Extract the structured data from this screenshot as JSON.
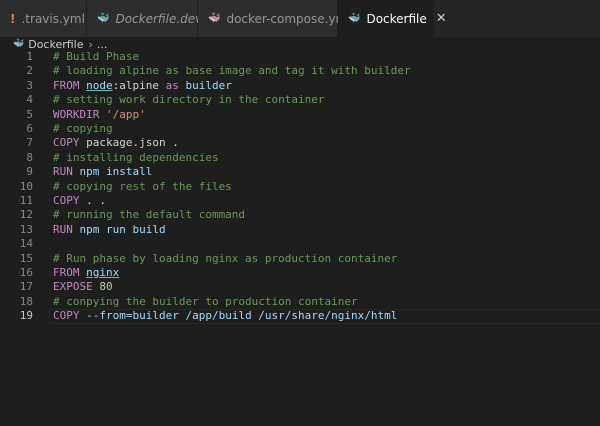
{
  "tabs": [
    {
      "label": ".travis.yml",
      "icon": "exclamation-icon",
      "icon_glyph": "!",
      "icon_color": "#e37933",
      "italic": false
    },
    {
      "label": "Dockerfile.dev",
      "icon": "docker-whale-icon",
      "icon_glyph": "🐳",
      "icon_color": "#519aba",
      "italic": true
    },
    {
      "label": "docker-compose.yml",
      "icon": "docker-compose-icon",
      "icon_glyph": "🐳",
      "icon_color": "#e44b7b",
      "italic": false
    },
    {
      "label": "Dockerfile",
      "icon": "docker-whale-icon",
      "icon_glyph": "🐳",
      "icon_color": "#519aba",
      "italic": false,
      "active": true,
      "close_glyph": "✕"
    }
  ],
  "breadcrumb": {
    "file": "Dockerfile",
    "sep": "›",
    "more": "..."
  },
  "editor": {
    "current_line": 19,
    "lines": [
      {
        "n": "1",
        "tokens": [
          {
            "t": "# Build Phase",
            "c": "cmt"
          }
        ]
      },
      {
        "n": "2",
        "tokens": [
          {
            "t": "# loading alpine as base image and tag it with builder",
            "c": "cmt"
          }
        ]
      },
      {
        "n": "3",
        "tokens": [
          {
            "t": "FROM",
            "c": "kw"
          },
          {
            "t": " "
          },
          {
            "t": "node",
            "c": "arg ul"
          },
          {
            "t": ":alpine "
          },
          {
            "t": "as",
            "c": "kw"
          },
          {
            "t": " builder",
            "c": "arg"
          }
        ]
      },
      {
        "n": "4",
        "tokens": [
          {
            "t": "# setting work directory in the container",
            "c": "cmt"
          }
        ]
      },
      {
        "n": "5",
        "tokens": [
          {
            "t": "WORKDIR",
            "c": "kw"
          },
          {
            "t": " "
          },
          {
            "t": "'/app'",
            "c": "str"
          }
        ]
      },
      {
        "n": "6",
        "tokens": [
          {
            "t": "# copying",
            "c": "cmt"
          }
        ]
      },
      {
        "n": "7",
        "tokens": [
          {
            "t": "COPY",
            "c": "kw"
          },
          {
            "t": " package.json ."
          }
        ]
      },
      {
        "n": "8",
        "tokens": [
          {
            "t": "# installing dependencies",
            "c": "cmt"
          }
        ]
      },
      {
        "n": "9",
        "tokens": [
          {
            "t": "RUN",
            "c": "kw"
          },
          {
            "t": " npm install",
            "c": "arg"
          }
        ]
      },
      {
        "n": "10",
        "tokens": [
          {
            "t": "# copying rest of the files",
            "c": "cmt"
          }
        ]
      },
      {
        "n": "11",
        "tokens": [
          {
            "t": "COPY",
            "c": "kw"
          },
          {
            "t": " . ."
          }
        ]
      },
      {
        "n": "12",
        "tokens": [
          {
            "t": "# running the default command",
            "c": "cmt"
          }
        ]
      },
      {
        "n": "13",
        "tokens": [
          {
            "t": "RUN",
            "c": "kw"
          },
          {
            "t": " npm run build",
            "c": "arg"
          }
        ]
      },
      {
        "n": "14",
        "tokens": []
      },
      {
        "n": "15",
        "tokens": [
          {
            "t": "# Run phase by loading nginx as production container",
            "c": "cmt"
          }
        ]
      },
      {
        "n": "16",
        "tokens": [
          {
            "t": "FROM",
            "c": "kw"
          },
          {
            "t": " "
          },
          {
            "t": "nginx",
            "c": "arg ul"
          }
        ]
      },
      {
        "n": "17",
        "tokens": [
          {
            "t": "EXPOSE",
            "c": "kw"
          },
          {
            "t": " "
          },
          {
            "t": "80",
            "c": "num"
          }
        ]
      },
      {
        "n": "18",
        "tokens": [
          {
            "t": "# conpying the builder to production container",
            "c": "cmt"
          }
        ]
      },
      {
        "n": "19",
        "tokens": [
          {
            "t": "COPY",
            "c": "kw"
          },
          {
            "t": " --from=builder /app/build /usr/share/nginx/html",
            "c": "arg"
          }
        ]
      }
    ]
  }
}
